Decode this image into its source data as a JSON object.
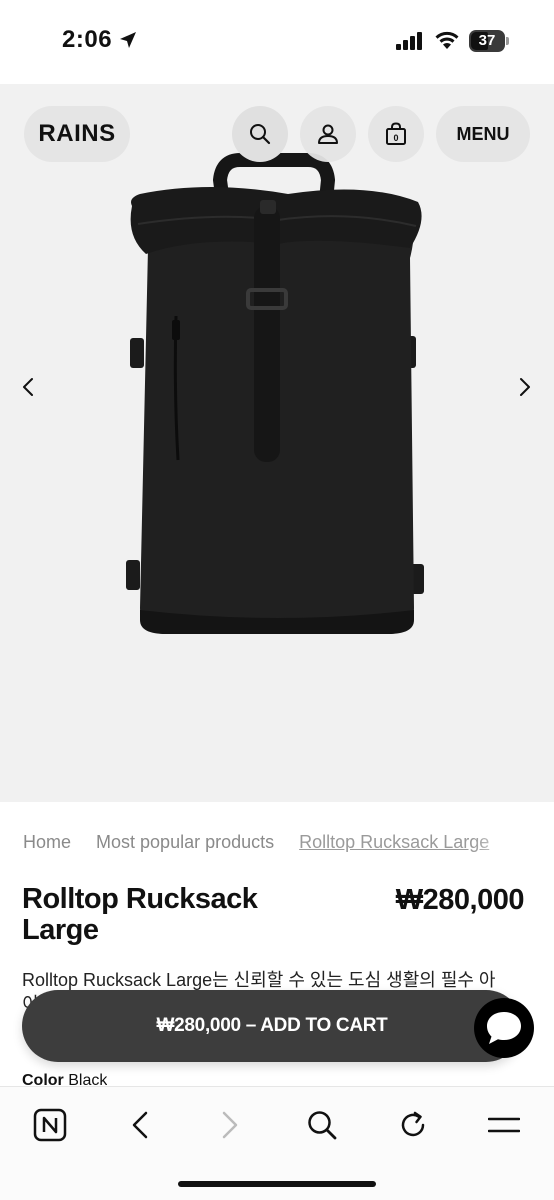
{
  "status_bar": {
    "time": "2:06",
    "battery_level": "37",
    "icons": [
      "location-arrow-icon",
      "cellular-signal-icon",
      "wifi-icon",
      "battery-icon"
    ]
  },
  "header": {
    "logo": "RAINS",
    "menu_label": "MENU",
    "cart_count": "0",
    "icons": [
      "search-icon",
      "account-icon",
      "shopping-bag-icon"
    ]
  },
  "gallery": {
    "icons": [
      "chevron-left-icon",
      "chevron-right-icon"
    ],
    "image_subject": "black rolltop backpack"
  },
  "breadcrumb": {
    "items": [
      "Home",
      "Most popular products",
      "Rolltop Rucksack Large"
    ]
  },
  "product": {
    "title": "Rolltop Rucksack Large",
    "price": "₩280,000",
    "description_line1": "Rolltop Rucksack Large는 신뢰할 수 있는 도심 생활의 필수 아",
    "description_line2": "이",
    "color_label": "Color",
    "color_value": "Black"
  },
  "cta": {
    "add_to_cart_label": "₩280,000 – ADD TO CART",
    "chat_icon": "chat-bubble-icon"
  },
  "browser_toolbar": {
    "icons": [
      "app-n-icon",
      "back-icon",
      "forward-icon",
      "search-icon",
      "reload-icon",
      "menu-icon"
    ]
  },
  "colors": {
    "hero_background": "#f1f1f1",
    "cta_background": "#3d3d3d",
    "text": "#111111",
    "muted_text": "#8a8a8a"
  }
}
